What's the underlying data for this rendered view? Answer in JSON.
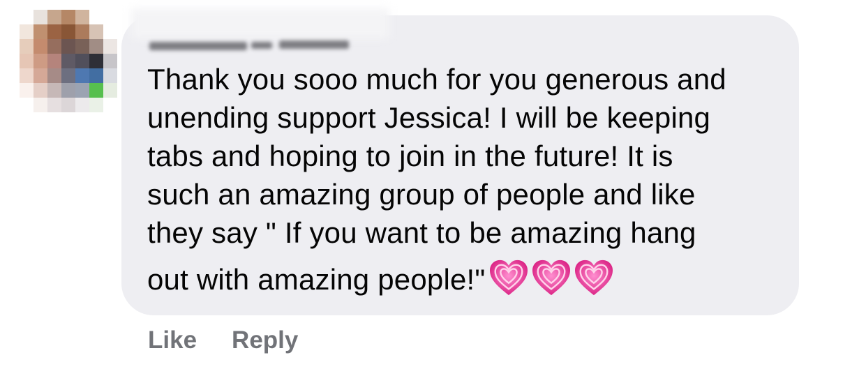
{
  "comment": {
    "author_name_visible": "",
    "text_lines": [
      "Thank you sooo much for you generous and",
      "unending support Jessica! I will be keeping",
      "tabs and hoping to join in the future! It is",
      "such an amazing group of people and like",
      "they say \" If you want to be amazing hang",
      "out with amazing people!\""
    ],
    "emoji": [
      "growing-heart-icon",
      "growing-heart-icon",
      "growing-heart-icon"
    ]
  },
  "actions": {
    "like_label": "Like",
    "reply_label": "Reply"
  },
  "colors": {
    "bubble_bg": "#eeeef2",
    "text": "#050505",
    "action_text": "#717378",
    "heart_pink": "#e8349a"
  }
}
